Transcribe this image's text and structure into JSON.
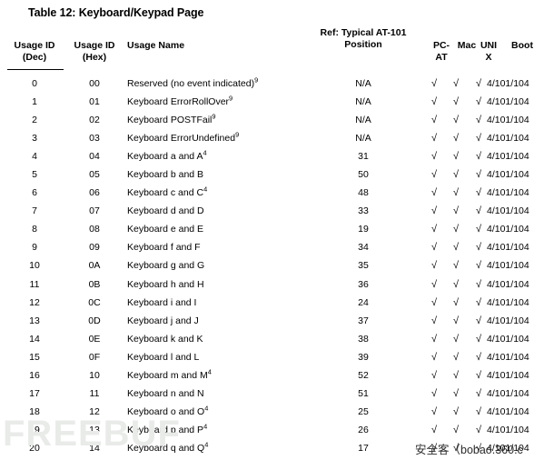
{
  "document": {
    "title": "Table 12: Keyboard/Keypad Page"
  },
  "table": {
    "headers": {
      "usage_id_dec_line1": "Usage ID",
      "usage_id_dec_line2": "(Dec)",
      "usage_id_hex_line1": "Usage ID",
      "usage_id_hex_line2": "(Hex)",
      "usage_name": "Usage Name",
      "ref_position_line1": "Ref: Typical AT-101",
      "ref_position_line2": "Position",
      "pc_at_line1": "PC-",
      "pc_at_line2": "AT",
      "mac": "Mac",
      "unix_line1": "UNI",
      "unix_line2": "X",
      "boot": "Boot"
    },
    "check_glyph": "√",
    "rows": [
      {
        "dec": "0",
        "hex": "00",
        "name": "Reserved (no event indicated)",
        "name_sup": "9",
        "position": "N/A",
        "pc_at": true,
        "mac": true,
        "unix": true,
        "boot": "4/101/104"
      },
      {
        "dec": "1",
        "hex": "01",
        "name": "Keyboard ErrorRollOver",
        "name_sup": "9",
        "position": "N/A",
        "pc_at": true,
        "mac": true,
        "unix": true,
        "boot": "4/101/104"
      },
      {
        "dec": "2",
        "hex": "02",
        "name": "Keyboard POSTFail",
        "name_sup": "9",
        "position": "N/A",
        "pc_at": true,
        "mac": true,
        "unix": true,
        "boot": "4/101/104"
      },
      {
        "dec": "3",
        "hex": "03",
        "name": "Keyboard ErrorUndefined",
        "name_sup": "9",
        "position": "N/A",
        "pc_at": true,
        "mac": true,
        "unix": true,
        "boot": "4/101/104"
      },
      {
        "dec": "4",
        "hex": "04",
        "name": "Keyboard a and A",
        "name_sup": "4",
        "position": "31",
        "pc_at": true,
        "mac": true,
        "unix": true,
        "boot": "4/101/104"
      },
      {
        "dec": "5",
        "hex": "05",
        "name": "Keyboard b and B",
        "name_sup": "",
        "position": "50",
        "pc_at": true,
        "mac": true,
        "unix": true,
        "boot": "4/101/104"
      },
      {
        "dec": "6",
        "hex": "06",
        "name": "Keyboard c and C",
        "name_sup": "4",
        "position": "48",
        "pc_at": true,
        "mac": true,
        "unix": true,
        "boot": "4/101/104"
      },
      {
        "dec": "7",
        "hex": "07",
        "name": "Keyboard d and D",
        "name_sup": "",
        "position": "33",
        "pc_at": true,
        "mac": true,
        "unix": true,
        "boot": "4/101/104"
      },
      {
        "dec": "8",
        "hex": "08",
        "name": "Keyboard e and E",
        "name_sup": "",
        "position": "19",
        "pc_at": true,
        "mac": true,
        "unix": true,
        "boot": "4/101/104"
      },
      {
        "dec": "9",
        "hex": "09",
        "name": "Keyboard f and F",
        "name_sup": "",
        "position": "34",
        "pc_at": true,
        "mac": true,
        "unix": true,
        "boot": "4/101/104"
      },
      {
        "dec": "10",
        "hex": "0A",
        "name": "Keyboard g and G",
        "name_sup": "",
        "position": "35",
        "pc_at": true,
        "mac": true,
        "unix": true,
        "boot": "4/101/104"
      },
      {
        "dec": "11",
        "hex": "0B",
        "name": "Keyboard h and H",
        "name_sup": "",
        "position": "36",
        "pc_at": true,
        "mac": true,
        "unix": true,
        "boot": "4/101/104"
      },
      {
        "dec": "12",
        "hex": "0C",
        "name": "Keyboard i and I",
        "name_sup": "",
        "position": "24",
        "pc_at": true,
        "mac": true,
        "unix": true,
        "boot": "4/101/104"
      },
      {
        "dec": "13",
        "hex": "0D",
        "name": "Keyboard j and J",
        "name_sup": "",
        "position": "37",
        "pc_at": true,
        "mac": true,
        "unix": true,
        "boot": "4/101/104"
      },
      {
        "dec": "14",
        "hex": "0E",
        "name": "Keyboard k and K",
        "name_sup": "",
        "position": "38",
        "pc_at": true,
        "mac": true,
        "unix": true,
        "boot": "4/101/104"
      },
      {
        "dec": "15",
        "hex": "0F",
        "name": "Keyboard l and L",
        "name_sup": "",
        "position": "39",
        "pc_at": true,
        "mac": true,
        "unix": true,
        "boot": "4/101/104"
      },
      {
        "dec": "16",
        "hex": "10",
        "name": "Keyboard m and M",
        "name_sup": "4",
        "position": "52",
        "pc_at": true,
        "mac": true,
        "unix": true,
        "boot": "4/101/104"
      },
      {
        "dec": "17",
        "hex": "11",
        "name": "Keyboard n and N",
        "name_sup": "",
        "position": "51",
        "pc_at": true,
        "mac": true,
        "unix": true,
        "boot": "4/101/104"
      },
      {
        "dec": "18",
        "hex": "12",
        "name": "Keyboard o and O",
        "name_sup": "4",
        "position": "25",
        "pc_at": true,
        "mac": true,
        "unix": true,
        "boot": "4/101/104"
      },
      {
        "dec": "19",
        "hex": "13",
        "name": "Keyboard p and P",
        "name_sup": "4",
        "position": "26",
        "pc_at": true,
        "mac": true,
        "unix": true,
        "boot": "4/101/104"
      },
      {
        "dec": "20",
        "hex": "14",
        "name": "Keyboard q and Q",
        "name_sup": "4",
        "position": "17",
        "pc_at": true,
        "mac": true,
        "unix": true,
        "boot": "4/101/104"
      }
    ]
  },
  "watermarks": {
    "freebuf": "FREEBUF",
    "anquanke": "安全客（bobao.360.c"
  }
}
